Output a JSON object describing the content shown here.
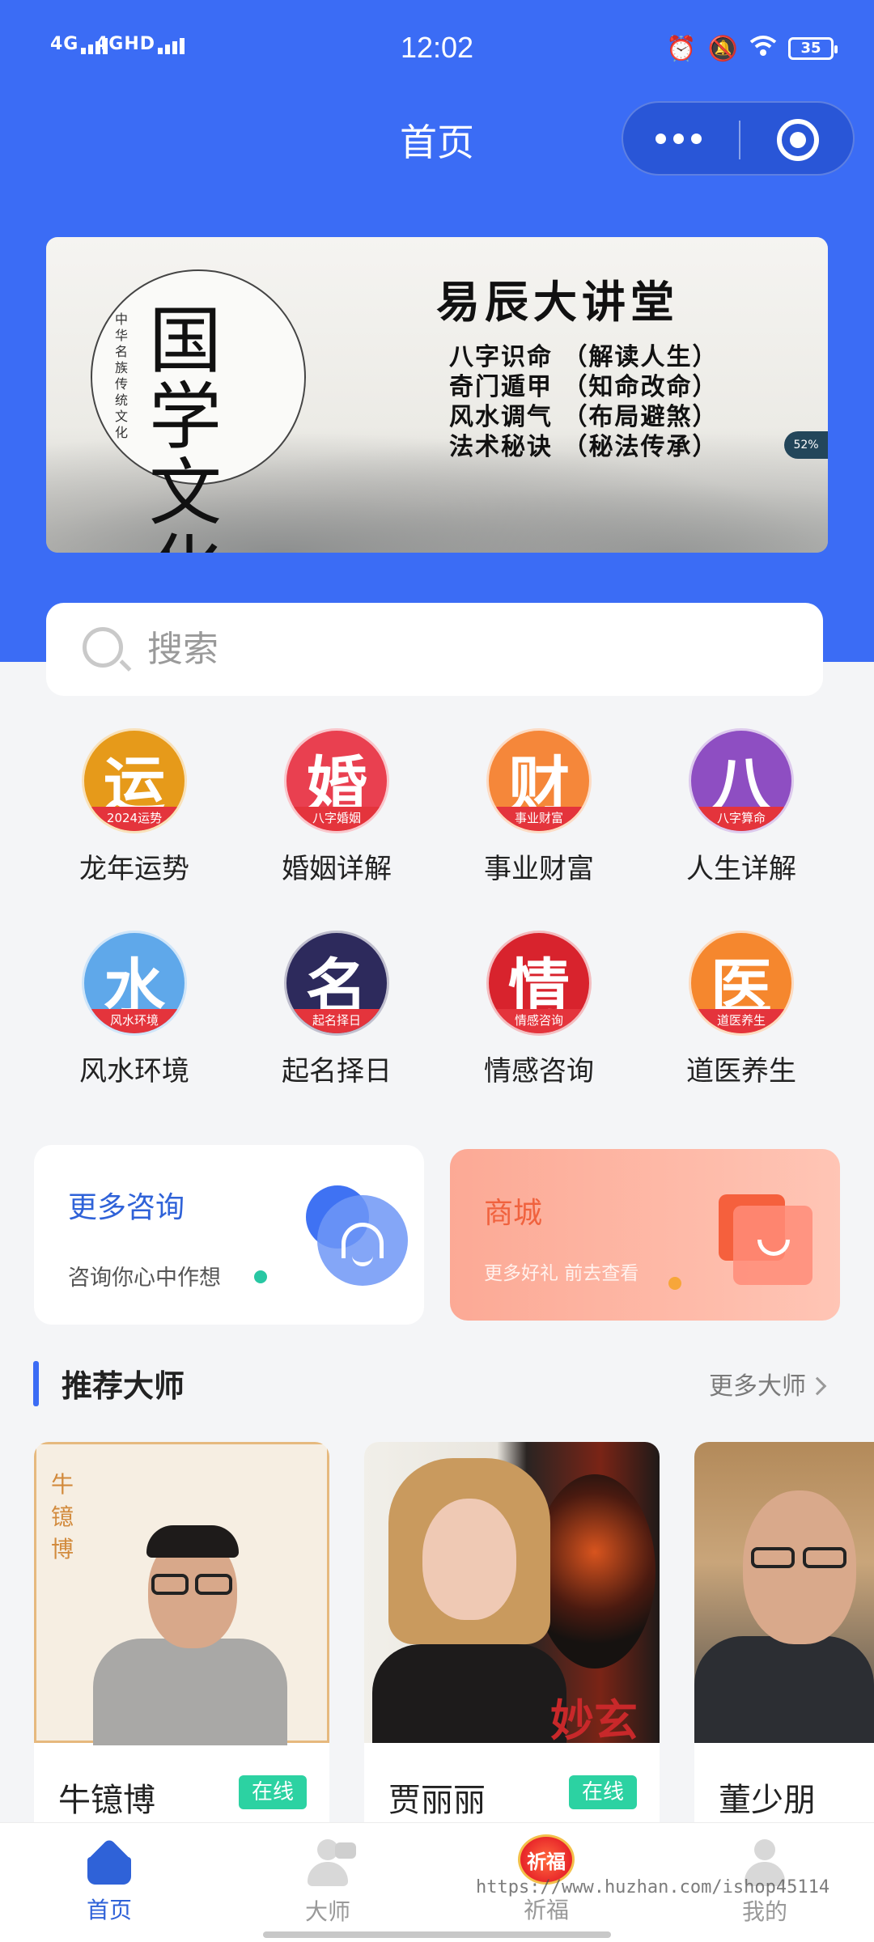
{
  "status_bar": {
    "signal_1": "4G",
    "signal_2": "4GHD",
    "time": "12:02",
    "battery": "35",
    "icons": [
      "alarm-icon",
      "mute-icon",
      "wifi-icon",
      "battery-icon"
    ]
  },
  "nav": {
    "title": "首页"
  },
  "banner": {
    "title": "易辰大讲堂",
    "lines": [
      "八字识命 （解读人生）",
      "奇门遁甲 （知命改命）",
      "风水调气 （布局避煞）",
      "法术秘诀 （秘法传承）"
    ],
    "seal_text": "国学文化",
    "seal_vertical": "中华名族传统文化",
    "badge": "52%"
  },
  "search": {
    "placeholder": "搜索"
  },
  "categories": [
    {
      "char": "运",
      "sub": "2024运势",
      "label": "龙年运势",
      "color": "#e69a1a"
    },
    {
      "char": "婚",
      "sub": "八字婚姻",
      "label": "婚姻详解",
      "color": "#e94050"
    },
    {
      "char": "财",
      "sub": "事业财富",
      "label": "事业财富",
      "color": "#f5873a"
    },
    {
      "char": "八",
      "sub": "八字算命",
      "label": "人生详解",
      "color": "#8e4ec2"
    },
    {
      "char": "水",
      "sub": "风水环境",
      "label": "风水环境",
      "color": "#5fa8ea"
    },
    {
      "char": "名",
      "sub": "起名择日",
      "label": "起名择日",
      "color": "#2d2a5c"
    },
    {
      "char": "情",
      "sub": "情感咨询",
      "label": "情感咨询",
      "color": "#d8232d"
    },
    {
      "char": "医",
      "sub": "道医养生",
      "label": "道医养生",
      "color": "#f5872e"
    }
  ],
  "promos": {
    "consult": {
      "title": "更多咨询",
      "subtitle": "咨询你心中作想"
    },
    "shop": {
      "title": "商城",
      "subtitle": "更多好礼 前去查看"
    }
  },
  "masters_section": {
    "title": "推荐大师",
    "more": "更多大师"
  },
  "masters": [
    {
      "name": "牛镱博",
      "status": "在线",
      "photo_caption": "牛镱博"
    },
    {
      "name": "贾丽丽",
      "status": "在线",
      "photo_caption": "妙玄"
    },
    {
      "name": "董少朋",
      "status": ""
    }
  ],
  "tabs": [
    {
      "label": "首页",
      "active": true
    },
    {
      "label": "大师",
      "active": false
    },
    {
      "label": "祈福",
      "active": false,
      "badge": "祈福"
    },
    {
      "label": "我的",
      "active": false
    }
  ],
  "watermark": "https://www.huzhan.com/ishop45114",
  "colors": {
    "primary": "#3b6cf5",
    "online": "#2cd2a2",
    "shop": "#f0623e"
  }
}
